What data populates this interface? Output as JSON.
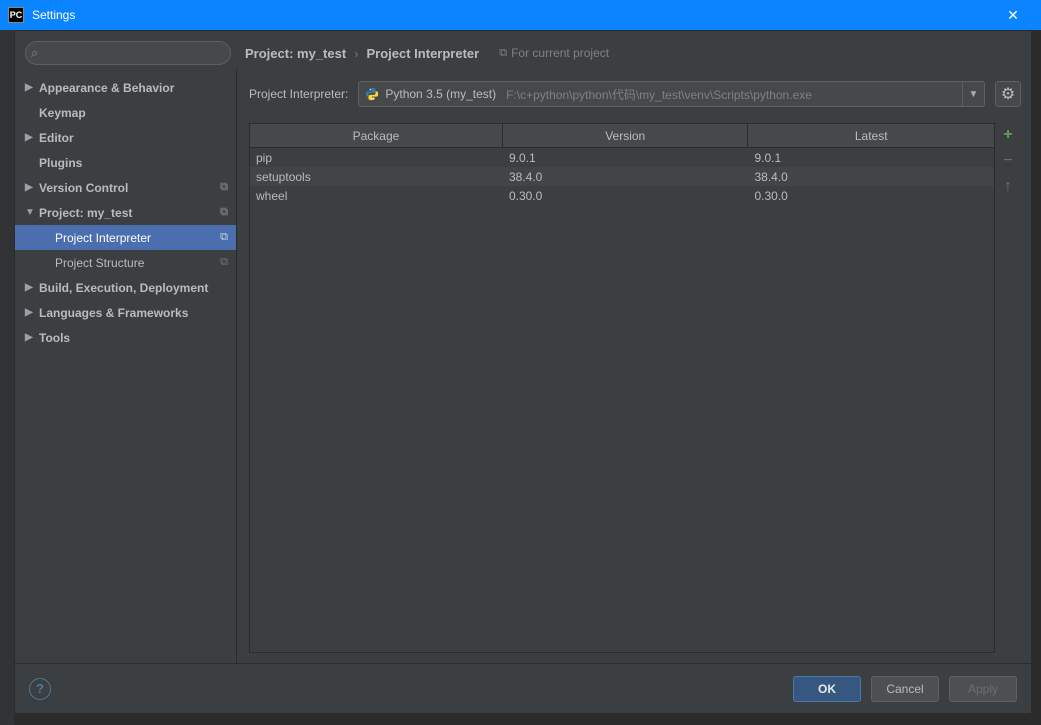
{
  "window": {
    "title": "Settings"
  },
  "breadcrumb": {
    "project": "Project: my_test",
    "page": "Project Interpreter",
    "hint": "For current project"
  },
  "sidebar": {
    "items": [
      {
        "label": "Appearance & Behavior",
        "bold": true,
        "expander": "▶"
      },
      {
        "label": "Keymap",
        "bold": true,
        "expander": ""
      },
      {
        "label": "Editor",
        "bold": true,
        "expander": "▶"
      },
      {
        "label": "Plugins",
        "bold": true,
        "expander": ""
      },
      {
        "label": "Version Control",
        "bold": true,
        "expander": "▶",
        "trail": true
      },
      {
        "label": "Project: my_test",
        "bold": true,
        "expander": "▼",
        "trail": true
      },
      {
        "label": "Project Interpreter",
        "bold": false,
        "child": true,
        "selected": true,
        "trail": true
      },
      {
        "label": "Project Structure",
        "bold": false,
        "child": true,
        "trail": true
      },
      {
        "label": "Build, Execution, Deployment",
        "bold": true,
        "expander": "▶"
      },
      {
        "label": "Languages & Frameworks",
        "bold": true,
        "expander": "▶"
      },
      {
        "label": "Tools",
        "bold": true,
        "expander": "▶"
      }
    ]
  },
  "interpreter": {
    "label": "Project Interpreter:",
    "name": "Python 3.5 (my_test)",
    "path": "F:\\c+python\\python\\代码\\my_test\\venv\\Scripts\\python.exe"
  },
  "table": {
    "headers": {
      "package": "Package",
      "version": "Version",
      "latest": "Latest"
    },
    "rows": [
      {
        "package": "pip",
        "version": "9.0.1",
        "latest": "9.0.1"
      },
      {
        "package": "setuptools",
        "version": "38.4.0",
        "latest": "38.4.0"
      },
      {
        "package": "wheel",
        "version": "0.30.0",
        "latest": "0.30.0"
      }
    ]
  },
  "footer": {
    "ok": "OK",
    "cancel": "Cancel",
    "apply": "Apply"
  }
}
